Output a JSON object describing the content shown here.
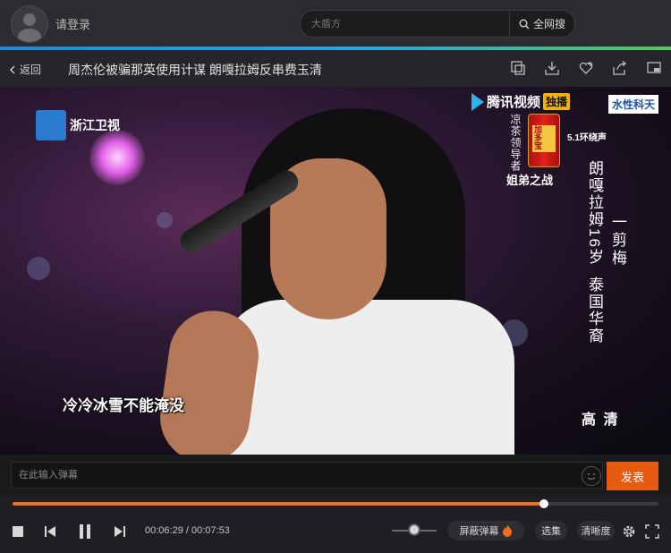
{
  "topbar": {
    "login_label": "请登录",
    "search_placeholder": "大盾方",
    "search_button_label": "全网搜"
  },
  "titlebar": {
    "back_label": "返回",
    "video_title": "周杰伦被骗那英使用计谋 朗嘎拉姆反串费玉清",
    "actions": [
      "screenshot-icon",
      "download-icon",
      "favorite-icon",
      "share-icon",
      "mini-player-icon"
    ]
  },
  "video": {
    "channel_logo_text": "浙江卫视",
    "platform_text": "腾讯视频",
    "exclusive_badge": "独播",
    "partner_text": "水性科天",
    "sponsor_vertical": "凉茶领导者",
    "sponsor_brand": "姐弟之战",
    "can_label": "加多宝",
    "surround_label": "5.1环绕声",
    "singer_name_vertical": "朗嘎拉姆16岁",
    "singer_origin_vertical": "泰国华裔",
    "song_name": "一剪梅",
    "lyric": "冷冷冰雪不能淹没",
    "quality_badge": "高 清"
  },
  "danmaku": {
    "input_placeholder": "在此输入弹幕",
    "send_label": "发表"
  },
  "player": {
    "current_time": "00:06:29",
    "total_time": "00:07:53",
    "time_separator": " / ",
    "progress_fraction": 0.8224,
    "volume_fraction": 0.5,
    "danmaku_toggle_label": "屏蔽弹幕",
    "episodes_label": "选集",
    "quality_label": "清晰度"
  },
  "colors": {
    "accent_orange": "#e85a10",
    "progress_orange": "#f26d1c",
    "top_accent_blue": "#1e8bd6",
    "top_accent_green": "#55c85a"
  }
}
